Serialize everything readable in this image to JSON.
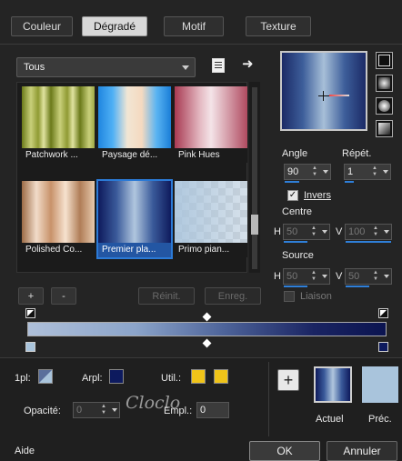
{
  "tabs": [
    {
      "label": "Couleur"
    },
    {
      "label": "Dégradé"
    },
    {
      "label": "Motif"
    },
    {
      "label": "Texture"
    }
  ],
  "library": {
    "filter": "Tous",
    "thumbs": [
      {
        "caption": "Patchwork ..."
      },
      {
        "caption": "Paysage dé..."
      },
      {
        "caption": "Pink Hues"
      },
      {
        "caption": "Polished Co..."
      },
      {
        "caption": "Premier pla..."
      },
      {
        "caption": "Primo pian..."
      }
    ],
    "add": "+",
    "remove": "-",
    "reset": "Réinit.",
    "save": "Enreg."
  },
  "controls": {
    "angle_label": "Angle",
    "angle": "90",
    "repeat_label": "Répét.",
    "repeat": "1",
    "invert_label": "Invers",
    "invert_checked": "✓",
    "center_label": "Centre",
    "center_h_label": "H",
    "center_h": "50",
    "center_v_label": "V",
    "center_v": "100",
    "source_label": "Source",
    "source_h_label": "H",
    "source_h": "50",
    "source_v_label": "V",
    "source_v": "50",
    "link_label": "Liaison"
  },
  "stops": {
    "pl_label": "1pl:",
    "arpl_label": "Arpl:",
    "util_label": "Util.:",
    "opacity_label": "Opacité:",
    "opacity": "0",
    "position_label": "Empl.:",
    "position": "0",
    "util_color1": "#f0c419",
    "util_color2": "#f0c419"
  },
  "result": {
    "current_label": "Actuel",
    "previous_label": "Préc.",
    "add_label": "+"
  },
  "footer": {
    "help": "Aide",
    "ok": "OK",
    "cancel": "Annuler"
  },
  "watermark": "Cloclo",
  "colors": {
    "accent": "#2f7fd8",
    "selected_caption": "#2356a3",
    "navy": "#0d1a5e",
    "light_blue": "#a9c4dc"
  }
}
